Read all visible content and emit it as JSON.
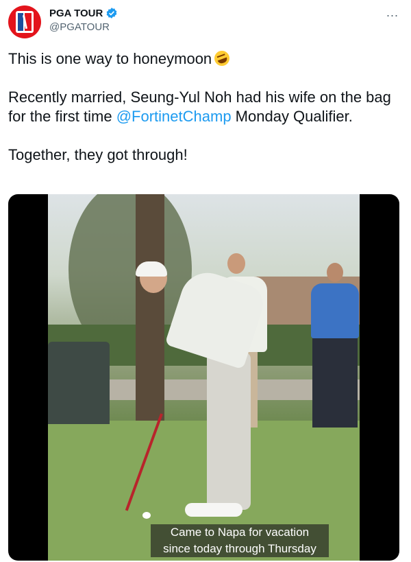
{
  "account": {
    "display_name": "PGA TOUR",
    "handle": "@PGATOUR",
    "avatar_icon": "pga-tour-logo",
    "verified_icon": "verified-badge-icon",
    "verified_color": "#1d9bf0"
  },
  "more_menu": {
    "icon": "more-options-icon",
    "label": "..."
  },
  "tweet": {
    "line1": "This is one way to honeymoon",
    "emoji_icon": "rolling-on-floor-laughing-emoji",
    "line2_part1": "Recently married, Seung-Yul Noh had his wife on the bag for the first time ",
    "mention": "@FortinetChamp",
    "line2_part2": " Monday Qualifier.",
    "line3": "Together, they got through!",
    "mention_color": "#1d9bf0"
  },
  "video": {
    "caption_line1": "Came to Napa for vacation",
    "caption_line2": "since today through Thursday"
  }
}
